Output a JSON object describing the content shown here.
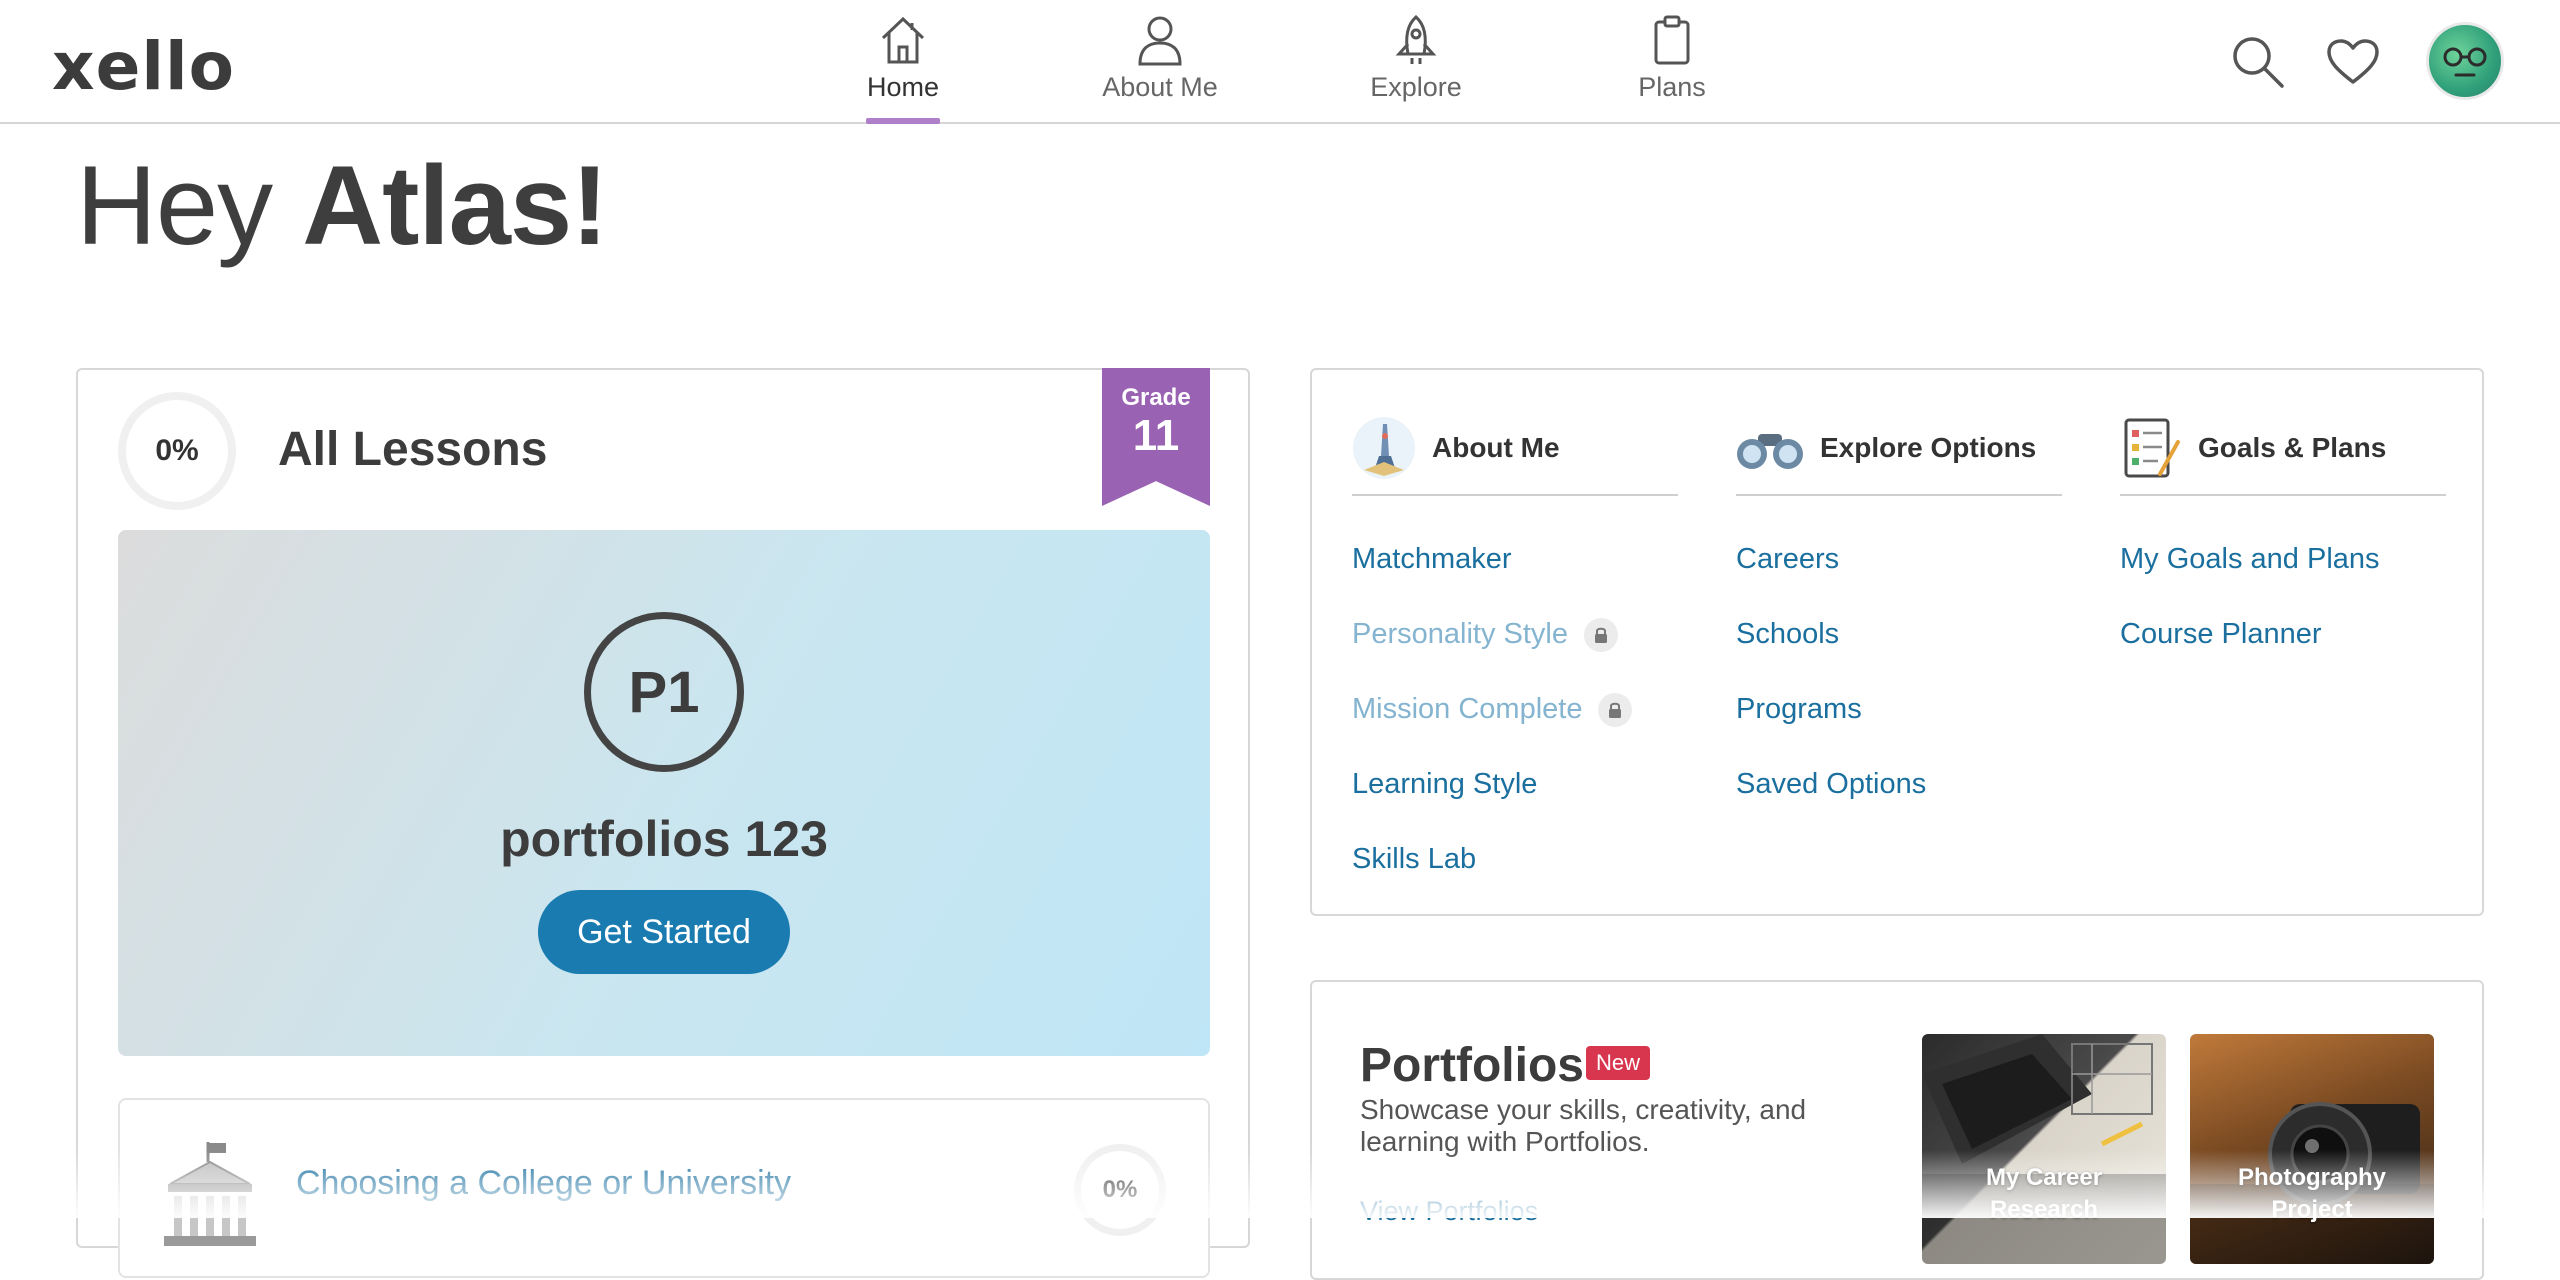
{
  "app": {
    "logo": "xello"
  },
  "nav": {
    "items": [
      {
        "label": "Home",
        "icon": "home-icon"
      },
      {
        "label": "About Me",
        "icon": "person-icon"
      },
      {
        "label": "Explore",
        "icon": "rocket-icon"
      },
      {
        "label": "Plans",
        "icon": "clipboard-icon"
      }
    ],
    "active": "Home",
    "accent": "#b07fc9"
  },
  "greeting": {
    "prefix": "Hey ",
    "name": "Atlas!"
  },
  "lessons": {
    "progress": "0%",
    "title": "All Lessons",
    "grade_label": "Grade",
    "grade_number": "11",
    "featured": {
      "badge": "P1",
      "title": "portfolios 123",
      "button": "Get Started"
    },
    "next": {
      "title": "Choosing a College or University",
      "progress": "0%",
      "icon": "college-building-icon"
    }
  },
  "quick_links": {
    "columns": [
      {
        "title": "About Me",
        "icon": "about-me-icon",
        "links": [
          {
            "label": "Matchmaker",
            "locked": false
          },
          {
            "label": "Personality Style",
            "locked": true
          },
          {
            "label": "Mission Complete",
            "locked": true
          },
          {
            "label": "Learning Style",
            "locked": false
          },
          {
            "label": "Skills Lab",
            "locked": false
          }
        ]
      },
      {
        "title": "Explore Options",
        "icon": "binoculars-icon",
        "links": [
          {
            "label": "Careers"
          },
          {
            "label": "Schools"
          },
          {
            "label": "Programs"
          },
          {
            "label": "Saved Options"
          }
        ]
      },
      {
        "title": "Goals & Plans",
        "icon": "checklist-icon",
        "links": [
          {
            "label": "My Goals and Plans"
          },
          {
            "label": "Course Planner"
          }
        ]
      }
    ]
  },
  "portfolios": {
    "title": "Portfolios",
    "badge": "New",
    "description": "Showcase your skills, creativity, and learning with Portfolios.",
    "link": "View Portfolios",
    "tiles": [
      {
        "line1": "My Career",
        "line2": "Research"
      },
      {
        "line1": "Photography",
        "line2": "Project"
      }
    ]
  },
  "colors": {
    "link": "#1a6f9f",
    "link_locked": "#84b4d0",
    "button": "#1a7bb0",
    "grade_ribbon": "#9a62b3",
    "new_badge": "#d8364f"
  }
}
